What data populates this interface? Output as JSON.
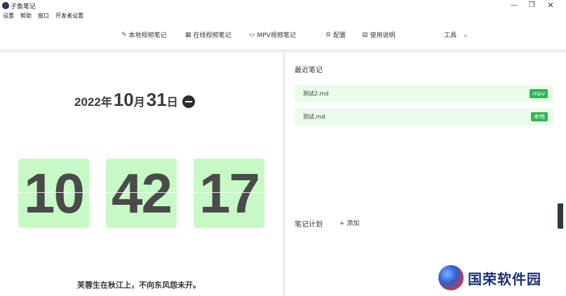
{
  "window": {
    "title": "子鱼笔记",
    "controls": {
      "minimize": "—",
      "maximize": "❐",
      "close": "✕"
    }
  },
  "menu": [
    "设置",
    "帮助",
    "窗口",
    "开发者设置"
  ],
  "nav": {
    "items": [
      {
        "icon": "edit-icon",
        "glyph": "✎",
        "label": "本地视频笔记"
      },
      {
        "icon": "table-icon",
        "glyph": "▦",
        "label": "在线视频笔记"
      },
      {
        "icon": "monitor-icon",
        "glyph": "▭",
        "label": "MPV视频笔记"
      },
      {
        "icon": "gear-icon",
        "glyph": "⚙",
        "label": "配置"
      },
      {
        "icon": "document-icon",
        "glyph": "▤",
        "label": "使用说明"
      }
    ],
    "tools": {
      "label": "工具",
      "chevron": "⌄"
    }
  },
  "clock": {
    "year": "2022",
    "year_unit": "年",
    "month": "10",
    "month_unit": "月",
    "day": "31",
    "day_unit": "日",
    "hours": "10",
    "minutes": "42",
    "seconds": "17",
    "poem": "芙蓉生在秋江上，不向东风怨未开。"
  },
  "recent": {
    "title": "最近笔记",
    "notes": [
      {
        "name": "测试2.md",
        "tag": "mpv"
      },
      {
        "name": "测试.md",
        "tag": "本地"
      }
    ]
  },
  "plan": {
    "title": "笔记计划",
    "add_label": "+ 添加"
  },
  "watermark": {
    "text": "国荣软件园"
  },
  "colors": {
    "flip_bg": "#c7f9c7",
    "note_bg": "#eafce9",
    "tag_bg": "#2fb457"
  }
}
